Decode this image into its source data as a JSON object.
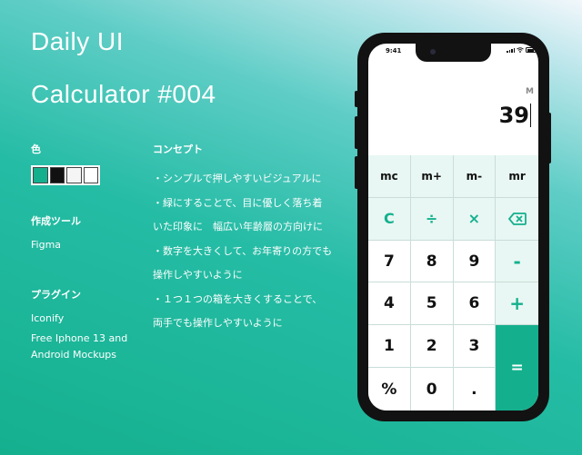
{
  "heading": {
    "line1": "Daily UI",
    "line2": "Calculator  #004"
  },
  "color": {
    "label": "色",
    "swatches": [
      "#14b08e",
      "#111111",
      "#f5f5f5",
      "#ffffff"
    ]
  },
  "tool": {
    "label": "作成ツール",
    "value": "Figma"
  },
  "plugin": {
    "label": "プラグイン",
    "items": [
      "Iconify",
      "Free Iphone 13 and",
      "Android Mockups"
    ]
  },
  "concept": {
    "label": "コンセプト",
    "lines": [
      "・シンプルで押しやすいビジュアルに",
      "・緑にすることで、目に優しく落ち着",
      "いた印象に　幅広い年齢層の方向けに",
      "・数字を大きくして、お年寄りの方でも",
      "操作しやすいように",
      "・１つ１つの箱を大きくすることで、",
      "両手でも操作しやすいように"
    ]
  },
  "phone": {
    "status_time": "9:41",
    "memory_indicator": "M",
    "display_value": "39",
    "keys": {
      "mc": "mc",
      "mplus": "m+",
      "mminus": "m-",
      "mr": "mr",
      "clear": "C",
      "divide": "÷",
      "multiply": "×",
      "seven": "7",
      "eight": "8",
      "nine": "9",
      "minus": "-",
      "four": "4",
      "five": "5",
      "six": "6",
      "plus": "+",
      "one": "1",
      "two": "2",
      "three": "3",
      "equals": "=",
      "percent": "%",
      "zero": "0",
      "decimal": "."
    },
    "icons": {
      "backspace": "backspace-icon"
    },
    "accent_color": "#14b08e",
    "key_tint_color": "#e8f7f3"
  }
}
